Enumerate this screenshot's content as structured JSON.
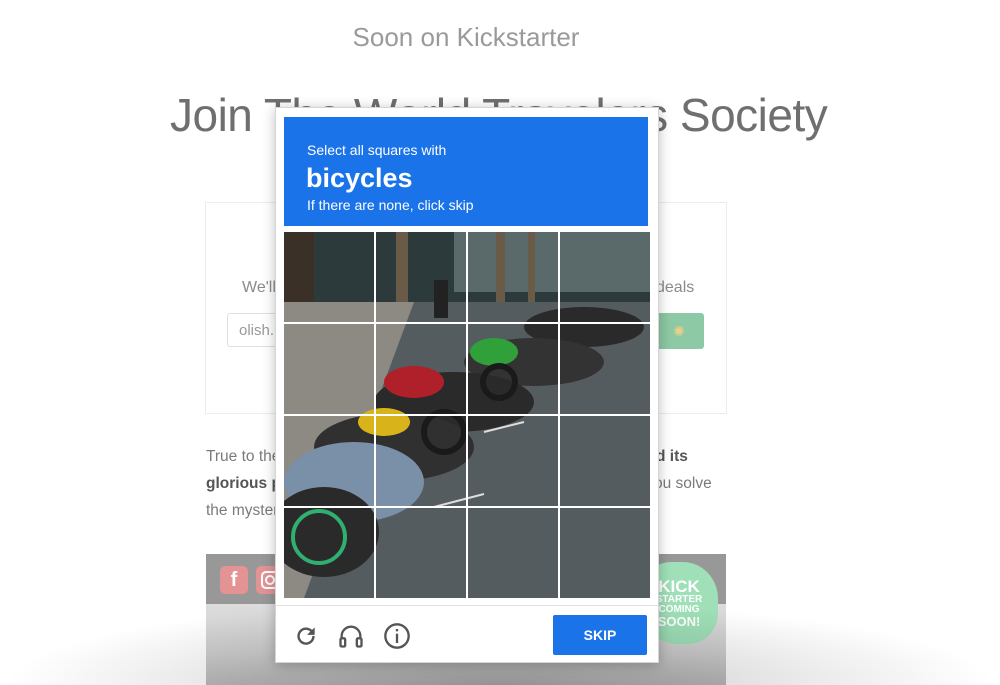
{
  "page": {
    "soon_label": "Soon on Kickstarter",
    "headline": "Join The World Travelers Society",
    "card": {
      "subtitle_left": "We'll",
      "subtitle_right": "deals",
      "email_value": "olish.",
      "subscribe_icon": "sun-icon"
    },
    "body": {
      "line1_left": "True to the",
      "line1_right_bold": "d its",
      "line2_left_bold": "glorious pa",
      "line2_right": "ou solve",
      "line3_left": "the myster"
    },
    "promo": {
      "social_icons": [
        "facebook-icon",
        "instagram-icon"
      ],
      "badge_lines": [
        "KICK",
        "STARTER",
        "COMING",
        "SOON!"
      ]
    }
  },
  "captcha": {
    "instruction": "Select all squares with",
    "target": "bicycles",
    "hint": "If there are none, click skip",
    "grid_rows": 4,
    "grid_cols": 4,
    "footer_icons": [
      "reload-icon",
      "headphones-icon",
      "info-icon"
    ],
    "skip_label": "SKIP",
    "colors": {
      "header": "#1a73e8",
      "skip_button": "#1a73e8"
    }
  }
}
